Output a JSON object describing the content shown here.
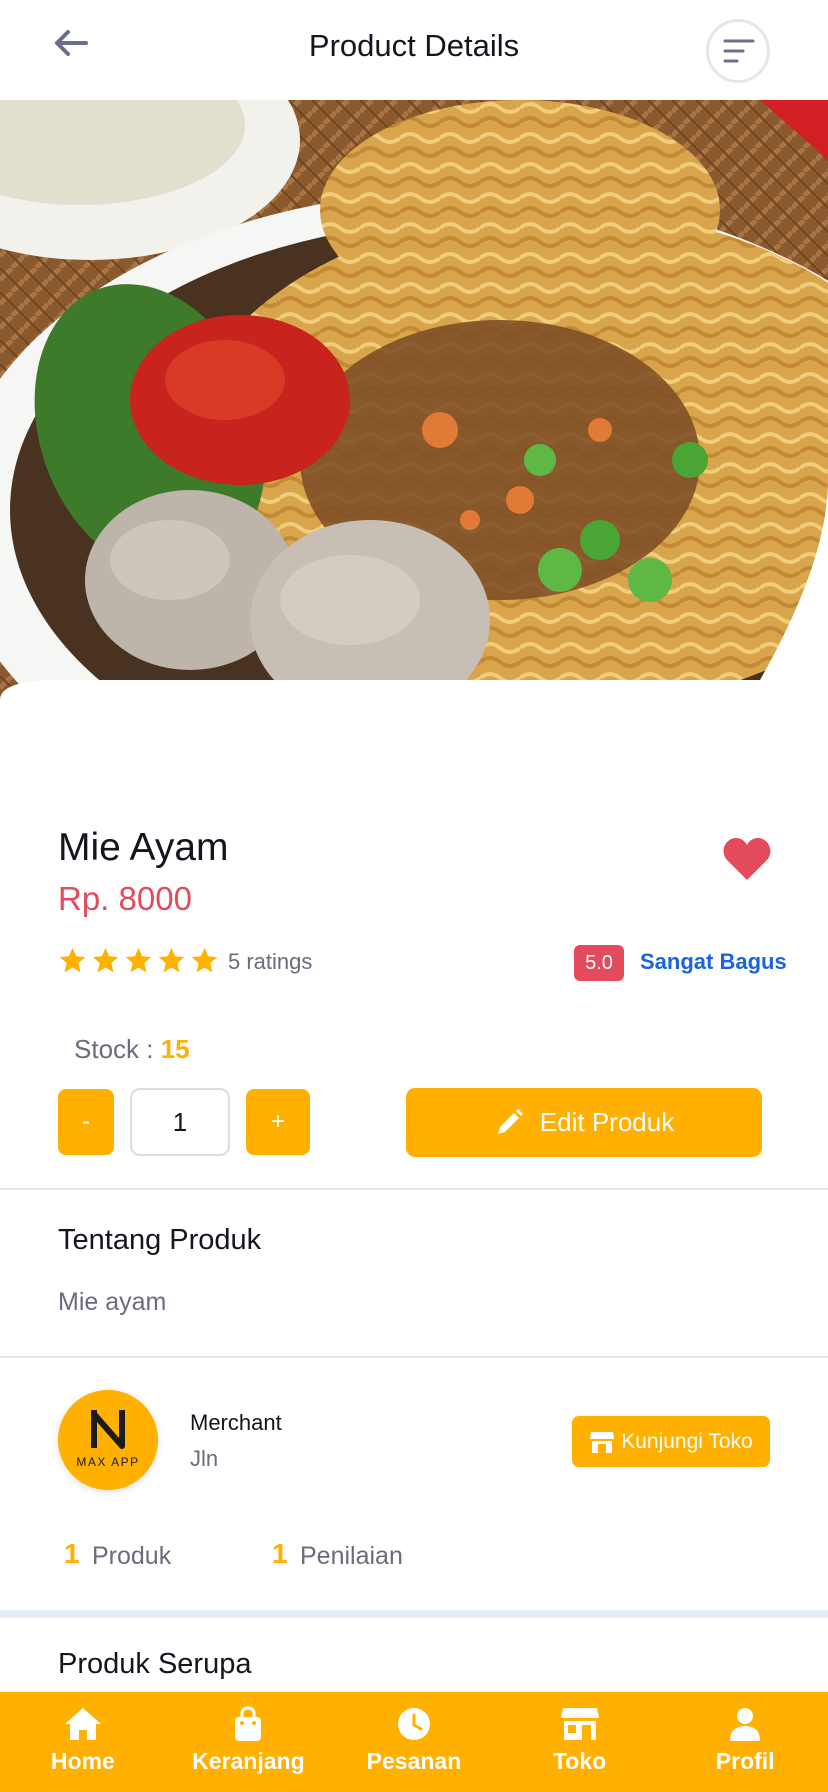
{
  "header": {
    "title": "Product Details",
    "back_icon": "arrow-left-icon",
    "menu_icon": "menu-lines-icon"
  },
  "product": {
    "name": "Mie Ayam",
    "price": "Rp. 8000",
    "rating_stars": 5,
    "rating_count": "5 ratings",
    "score": "5.0",
    "score_label": "Sangat Bagus",
    "stock_label": "Stock : ",
    "stock_value": "15",
    "quantity": "1",
    "minus_label": "-",
    "plus_label": "+",
    "edit_label": "Edit Produk",
    "favorite_icon": "heart-icon"
  },
  "about": {
    "title": "Tentang Produk",
    "description": "Mie ayam"
  },
  "merchant": {
    "logo_text": "MAX APP",
    "name": "Merchant",
    "address": "Jln",
    "visit_label": "Kunjungi Toko",
    "products_count": "1",
    "products_label": "Produk",
    "reviews_count": "1",
    "reviews_label": "Penilaian"
  },
  "similar": {
    "title": "Produk Serupa"
  },
  "nav": {
    "items": [
      {
        "label": "Home",
        "icon": "home-icon"
      },
      {
        "label": "Keranjang",
        "icon": "shopping-bag-icon"
      },
      {
        "label": "Pesanan",
        "icon": "clock-icon"
      },
      {
        "label": "Toko",
        "icon": "store-icon"
      },
      {
        "label": "Profil",
        "icon": "user-icon"
      }
    ]
  },
  "colors": {
    "accent": "#ffb000",
    "price": "#e34a5c",
    "link": "#1a64e0"
  }
}
